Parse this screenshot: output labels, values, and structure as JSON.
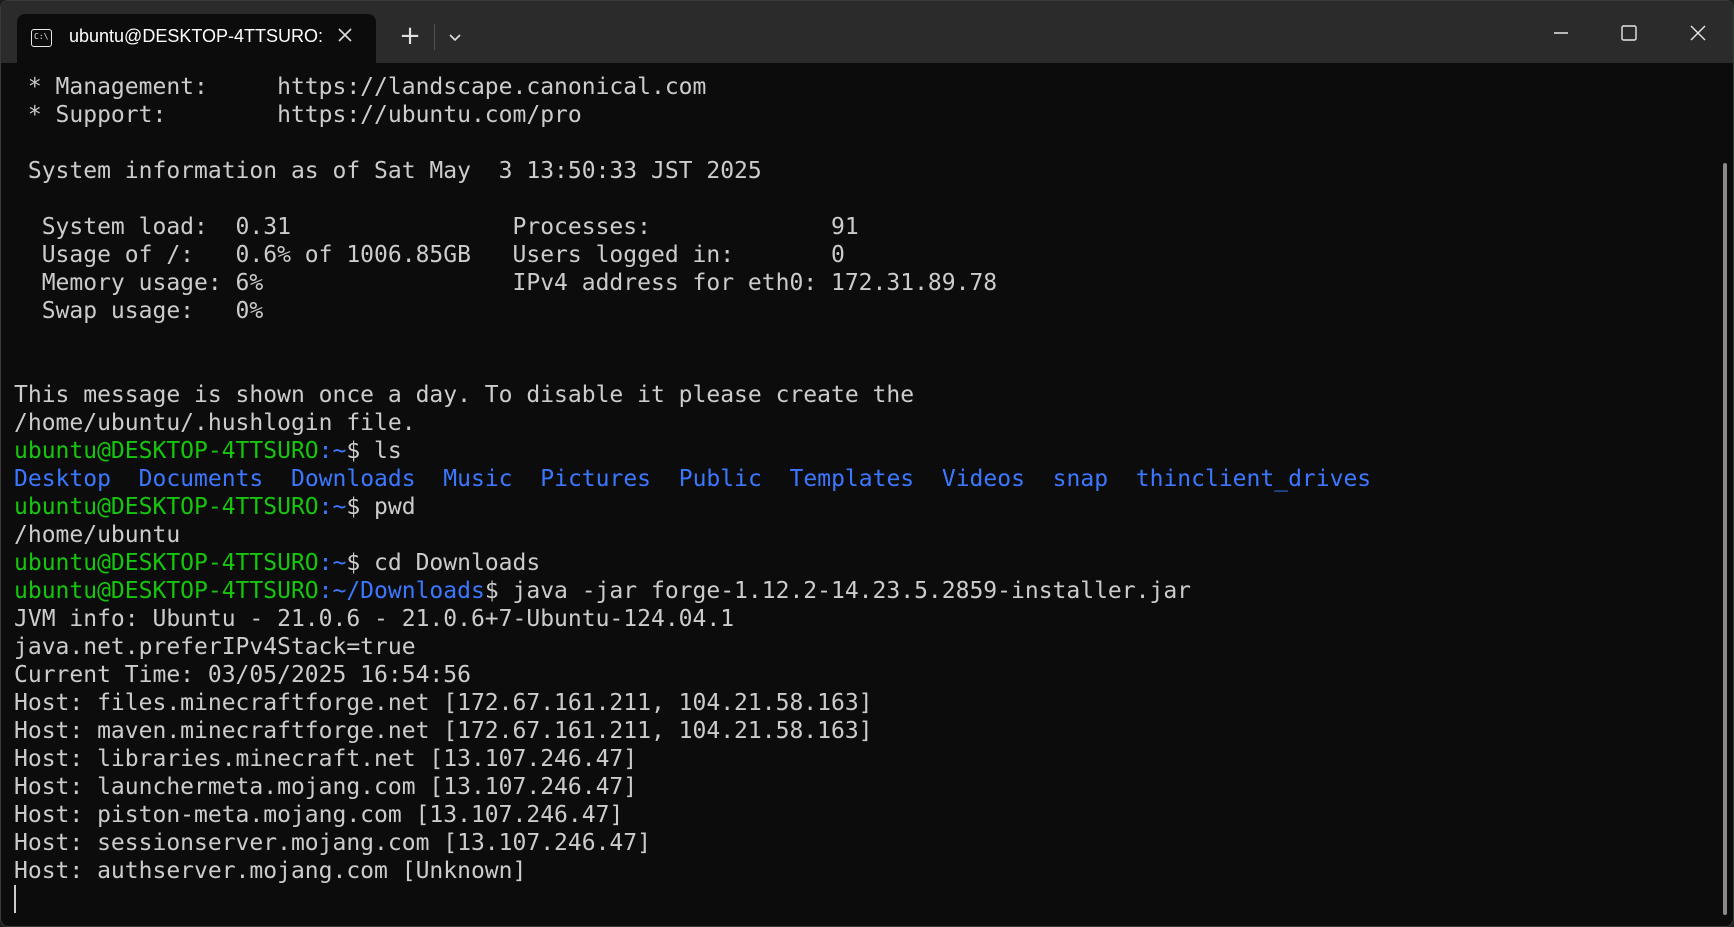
{
  "window": {
    "tab_title": "ubuntu@DESKTOP-4TTSURO:",
    "tab_icon": "terminal-icon",
    "new_tab_label": "+",
    "colors": {
      "titlebar": "#2b2b2b",
      "background": "#0c0c0c",
      "text": "#cccccc",
      "green": "#16c60c",
      "blue": "#3b78ff"
    }
  },
  "terminal": {
    "motd": [
      " * Management:     https://landscape.canonical.com",
      " * Support:        https://ubuntu.com/pro",
      "",
      " System information as of Sat May  3 13:50:33 JST 2025",
      "",
      "  System load:  0.31                Processes:             91",
      "  Usage of /:   0.6% of 1006.85GB   Users logged in:       0",
      "  Memory usage: 6%                  IPv4 address for eth0: 172.31.89.78",
      "  Swap usage:   0%",
      "",
      "",
      "This message is shown once a day. To disable it please create the",
      "/home/ubuntu/.hushlogin file."
    ],
    "prompt_user": "ubuntu@DESKTOP-4TTSURO",
    "cmd_ls": {
      "path": ":~",
      "command": "$ ls"
    },
    "ls_output": [
      "Desktop",
      "Documents",
      "Downloads",
      "Music",
      "Pictures",
      "Public",
      "Templates",
      "Videos",
      "snap",
      "thinclient_drives"
    ],
    "cmd_pwd": {
      "path": ":~",
      "command": "$ pwd"
    },
    "pwd_output": "/home/ubuntu",
    "cmd_cd": {
      "path": ":~",
      "command": "$ cd Downloads"
    },
    "cmd_java": {
      "path": ":~/Downloads",
      "command": "$ java -jar forge-1.12.2-14.23.5.2859-installer.jar"
    },
    "java_output": [
      "JVM info: Ubuntu - 21.0.6 - 21.0.6+7-Ubuntu-124.04.1",
      "java.net.preferIPv4Stack=true",
      "Current Time: 03/05/2025 16:54:56",
      "Host: files.minecraftforge.net [172.67.161.211, 104.21.58.163]",
      "Host: maven.minecraftforge.net [172.67.161.211, 104.21.58.163]",
      "Host: libraries.minecraft.net [13.107.246.47]",
      "Host: launchermeta.mojang.com [13.107.246.47]",
      "Host: piston-meta.mojang.com [13.107.246.47]",
      "Host: sessionserver.mojang.com [13.107.246.47]",
      "Host: authserver.mojang.com [Unknown]"
    ]
  }
}
